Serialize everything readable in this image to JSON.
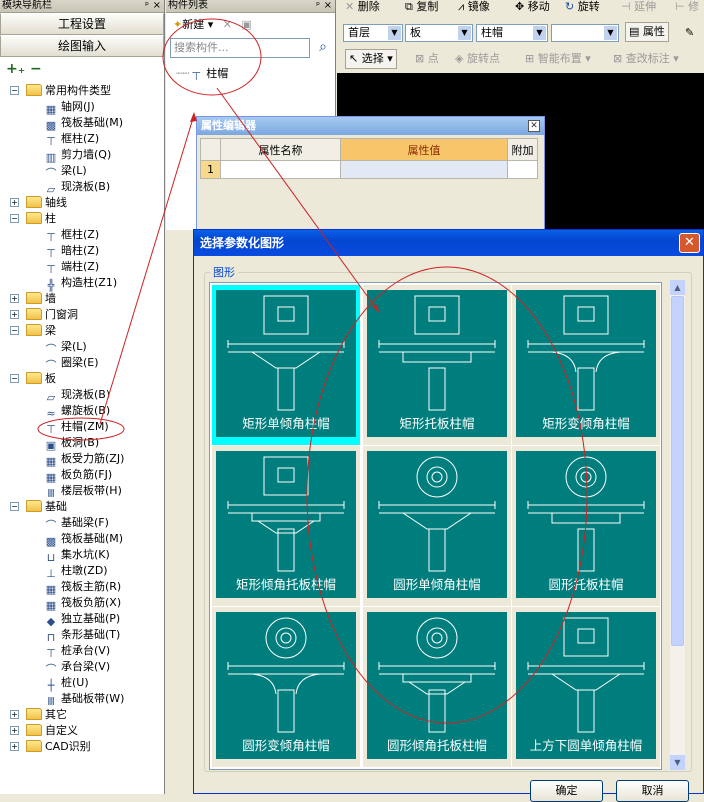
{
  "nav": {
    "title": "模块导航栏",
    "btn_project": "工程设置",
    "btn_draw": "绘图输入",
    "tree": [
      {
        "label": "常用构件类型",
        "type": "folder",
        "open": true,
        "depth": 0
      },
      {
        "label": "轴网(J)",
        "depth": 1,
        "icon": "grid-icon"
      },
      {
        "label": "筏板基础(M)",
        "depth": 1,
        "icon": "raft-icon"
      },
      {
        "label": "框柱(Z)",
        "depth": 1,
        "icon": "column-icon"
      },
      {
        "label": "剪力墙(Q)",
        "depth": 1,
        "icon": "wall-icon"
      },
      {
        "label": "梁(L)",
        "depth": 1,
        "icon": "beam-icon"
      },
      {
        "label": "现浇板(B)",
        "depth": 1,
        "icon": "slab-icon"
      },
      {
        "label": "轴线",
        "type": "folder",
        "open": false,
        "depth": 0
      },
      {
        "label": "柱",
        "type": "folder",
        "open": true,
        "depth": 0
      },
      {
        "label": "框柱(Z)",
        "depth": 1,
        "icon": "column-icon"
      },
      {
        "label": "暗柱(Z)",
        "depth": 1,
        "icon": "column-icon"
      },
      {
        "label": "端柱(Z)",
        "depth": 1,
        "icon": "column-icon"
      },
      {
        "label": "构造柱(Z1)",
        "depth": 1,
        "icon": "construct-column-icon"
      },
      {
        "label": "墙",
        "type": "folder",
        "open": false,
        "depth": 0
      },
      {
        "label": "门窗洞",
        "type": "folder",
        "open": false,
        "depth": 0
      },
      {
        "label": "梁",
        "type": "folder",
        "open": true,
        "depth": 0
      },
      {
        "label": "梁(L)",
        "depth": 1,
        "icon": "beam-icon"
      },
      {
        "label": "圈梁(E)",
        "depth": 1,
        "icon": "beam-icon"
      },
      {
        "label": "板",
        "type": "folder",
        "open": true,
        "depth": 0
      },
      {
        "label": "现浇板(B)",
        "depth": 1,
        "icon": "slab-icon"
      },
      {
        "label": "螺旋板(B)",
        "depth": 1,
        "icon": "spiral-slab-icon"
      },
      {
        "label": "柱帽(ZM)",
        "depth": 1,
        "icon": "column-cap-icon",
        "highlight": true
      },
      {
        "label": "板洞(B)",
        "depth": 1,
        "icon": "slab-hole-icon"
      },
      {
        "label": "板受力筋(ZJ)",
        "depth": 1,
        "icon": "rebar-icon"
      },
      {
        "label": "板负筋(FJ)",
        "depth": 1,
        "icon": "rebar-icon"
      },
      {
        "label": "楼层板带(H)",
        "depth": 1,
        "icon": "strip-icon"
      },
      {
        "label": "基础",
        "type": "folder",
        "open": true,
        "depth": 0
      },
      {
        "label": "基础梁(F)",
        "depth": 1,
        "icon": "beam-icon"
      },
      {
        "label": "筏板基础(M)",
        "depth": 1,
        "icon": "raft-icon"
      },
      {
        "label": "集水坑(K)",
        "depth": 1,
        "icon": "pit-icon"
      },
      {
        "label": "柱墩(ZD)",
        "depth": 1,
        "icon": "pier-icon"
      },
      {
        "label": "筏板主筋(R)",
        "depth": 1,
        "icon": "rebar-icon"
      },
      {
        "label": "筏板负筋(X)",
        "depth": 1,
        "icon": "rebar-icon"
      },
      {
        "label": "独立基础(P)",
        "depth": 1,
        "icon": "footing-icon"
      },
      {
        "label": "条形基础(T)",
        "depth": 1,
        "icon": "strip-footing-icon"
      },
      {
        "label": "桩承台(V)",
        "depth": 1,
        "icon": "pile-cap-icon"
      },
      {
        "label": "承台梁(V)",
        "depth": 1,
        "icon": "beam-icon"
      },
      {
        "label": "桩(U)",
        "depth": 1,
        "icon": "pile-icon"
      },
      {
        "label": "基础板带(W)",
        "depth": 1,
        "icon": "strip-icon"
      },
      {
        "label": "其它",
        "type": "folder",
        "open": false,
        "depth": 0
      },
      {
        "label": "自定义",
        "type": "folder",
        "open": false,
        "depth": 0
      },
      {
        "label": "CAD识别",
        "type": "folder",
        "open": false,
        "depth": 0
      }
    ]
  },
  "comp": {
    "title": "构件列表",
    "new_label": "新建",
    "search_placeholder": "搜索构件...",
    "item": "柱帽"
  },
  "toolbar": {
    "delete": "删除",
    "copy": "复制",
    "mirror": "镜像",
    "move": "移动",
    "rotate": "旋转",
    "extend": "延伸",
    "trim": "修",
    "floor": "首层",
    "category": "板",
    "component": "柱帽",
    "property": "属性",
    "select": "选择",
    "point": "点",
    "rotate_point": "旋转点",
    "smart_layout": "智能布置",
    "check_label": "查改标注"
  },
  "prop_editor": {
    "title": "属性编辑器",
    "col_name": "属性名称",
    "col_value": "属性值",
    "col_extra": "附加",
    "row_num": "1"
  },
  "dialog": {
    "title": "选择参数化图形",
    "group": "图形",
    "ok": "确定",
    "cancel": "取消",
    "shapes": [
      {
        "label": "矩形单倾角柱帽",
        "top": "rect",
        "cap": "single-slope"
      },
      {
        "label": "矩形托板柱帽",
        "top": "rect",
        "cap": "plate"
      },
      {
        "label": "矩形变倾角柱帽",
        "top": "rect",
        "cap": "variable-slope"
      },
      {
        "label": "矩形倾角托板柱帽",
        "top": "rect",
        "cap": "slope-plate"
      },
      {
        "label": "圆形单倾角柱帽",
        "top": "circle",
        "cap": "single-slope"
      },
      {
        "label": "圆形托板柱帽",
        "top": "circle",
        "cap": "plate"
      },
      {
        "label": "圆形变倾角柱帽",
        "top": "circle",
        "cap": "variable-slope"
      },
      {
        "label": "圆形倾角托板柱帽",
        "top": "circle",
        "cap": "slope-plate"
      },
      {
        "label": "上方下圆单倾角柱帽",
        "top": "rect",
        "cap": "single-slope"
      }
    ],
    "selected_index": 0
  },
  "colors": {
    "tile_bg": "#007e7e",
    "selected": "#00ffff",
    "annotation": "#cc2222"
  }
}
